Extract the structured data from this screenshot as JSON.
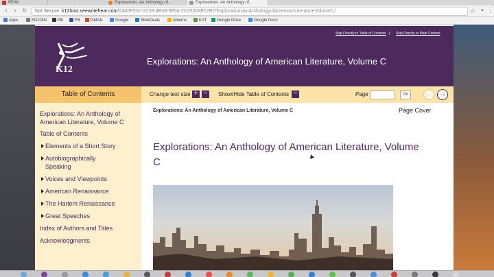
{
  "browser": {
    "tabs": [
      {
        "title": "PEAK"
      },
      {
        "title": "Explorations: An Anthology of..."
      },
      {
        "title": "Explorations: An Anthology of..."
      }
    ],
    "address": {
      "security": "Not Secure",
      "host": "k12host.seewritehear.com",
      "path": "/5A85F537-2C58-4B08-9F04-2D35324E07B7/ExplorationsAnAnthologyofAmericanLiteratureVolumeC/"
    },
    "bookmarks": [
      "Apps",
      "EDJOIN",
      "PB",
      "FB",
      "GMAIL",
      "Google",
      "SlickDeals",
      "Albums",
      "KAT",
      "Google Drive",
      "Google Docs"
    ]
  },
  "header": {
    "skip_toc": "Skip Directly to Table of Contents",
    "skip_main": "Skip Directly to Main Content",
    "separator": "|",
    "logo_text": "K12",
    "title": "Explorations: An Anthology of American Literature, Volume C"
  },
  "toolbar": {
    "toc_label": "Table of Contents",
    "change_text_size": "Change text size",
    "plus": "+",
    "minus": "−",
    "show_hide_toc": "Show/Hide Table of Contents",
    "toggle_minus": "−",
    "page_label": "Page",
    "go_label": "Go",
    "prev_arrow": "←",
    "next_arrow": "→"
  },
  "sidebar": {
    "items": [
      {
        "label": "Explorations: An Anthology of American Literature, Volume C",
        "expandable": false
      },
      {
        "label": "Table of Contents",
        "expandable": false
      },
      {
        "label": "Elements of a Short Story",
        "expandable": true
      },
      {
        "label": "Autobiographically Speaking",
        "expandable": true
      },
      {
        "label": "Voices and Viewpoints",
        "expandable": true
      },
      {
        "label": "American Renaissance",
        "expandable": true
      },
      {
        "label": "The Harlem Renaissance",
        "expandable": true
      },
      {
        "label": "Great Speeches",
        "expandable": true
      },
      {
        "label": "Index of Authors and Titles",
        "expandable": false
      },
      {
        "label": "Acknowledgments",
        "expandable": false
      }
    ]
  },
  "main": {
    "breadcrumb": "Explorations: An Anthology of American Literature, Volume C",
    "page_cover": "Page Cover",
    "heading": "Explorations: An Anthology of American Literature, Volume C"
  },
  "colors": {
    "brand_purple": "#4d2a5e",
    "toolbar_tan": "#fbe3a9",
    "toc_tab": "#f6c36c",
    "sidebar_bg": "#fdf0cf"
  }
}
